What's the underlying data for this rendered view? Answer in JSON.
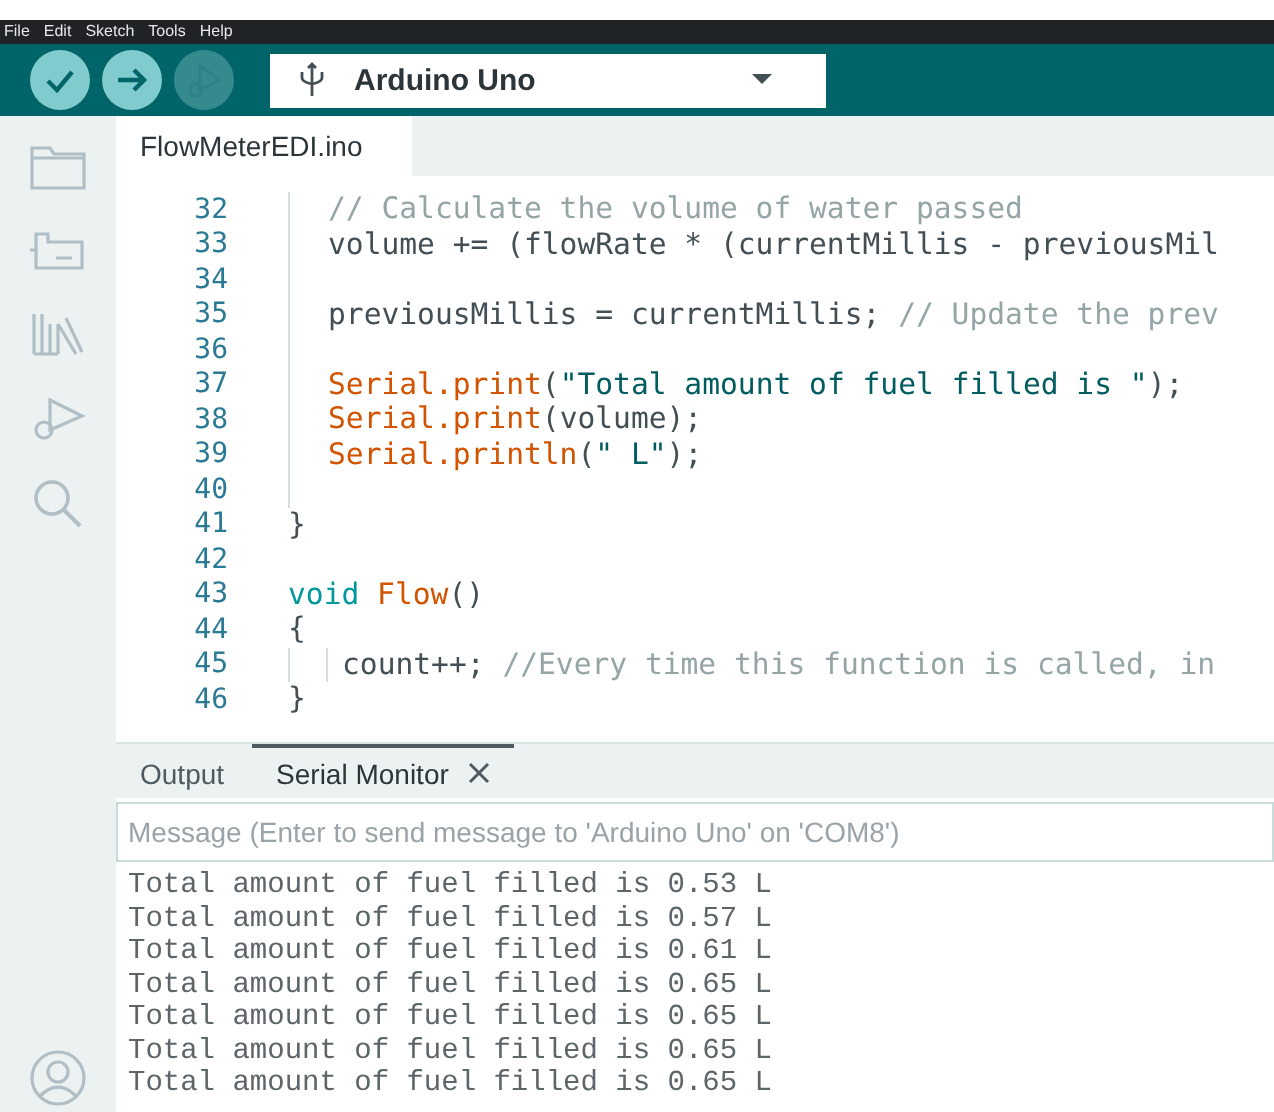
{
  "menu": [
    "File",
    "Edit",
    "Sketch",
    "Tools",
    "Help"
  ],
  "toolbar": {
    "buttons": [
      {
        "kind": "verify",
        "disabled": false
      },
      {
        "kind": "upload",
        "disabled": false
      },
      {
        "kind": "debug",
        "disabled": true
      }
    ],
    "board": "Arduino Uno"
  },
  "sidebar": {
    "items": [
      {
        "kind": "folder"
      },
      {
        "kind": "board"
      },
      {
        "kind": "library"
      },
      {
        "kind": "debug"
      },
      {
        "kind": "search"
      }
    ],
    "bottom": {
      "kind": "account"
    }
  },
  "editor": {
    "tab": "FlowMeterEDI.ino",
    "lines": [
      {
        "number": "32",
        "kind": "indented",
        "tokens": [
          {
            "kind": "comment",
            "text": "// Calculate the volume of water passed"
          }
        ]
      },
      {
        "number": "33",
        "kind": "indented",
        "tokens": [
          {
            "kind": "plain",
            "text": "volume += (flowRate * (currentMillis - previousMil"
          }
        ]
      },
      {
        "number": "34",
        "kind": "indented"
      },
      {
        "number": "35",
        "kind": "indented",
        "tokens": [
          {
            "kind": "plain",
            "text": "previousMillis = currentMillis; "
          },
          {
            "kind": "comment",
            "text": "// Update the prev"
          }
        ]
      },
      {
        "number": "36",
        "kind": "indented"
      },
      {
        "number": "37",
        "kind": "indented",
        "tokens": [
          {
            "kind": "function",
            "text": "Serial.print"
          },
          {
            "kind": "plain",
            "text": "("
          },
          {
            "kind": "string",
            "text": "\"Total amount of fuel filled is \""
          },
          {
            "kind": "plain",
            "text": ");"
          }
        ]
      },
      {
        "number": "38",
        "kind": "indented",
        "tokens": [
          {
            "kind": "function",
            "text": "Serial.print"
          },
          {
            "kind": "plain",
            "text": "(volume);"
          }
        ]
      },
      {
        "number": "39",
        "kind": "indented",
        "tokens": [
          {
            "kind": "function",
            "text": "Serial.println"
          },
          {
            "kind": "plain",
            "text": "("
          },
          {
            "kind": "string",
            "text": "\" L\""
          },
          {
            "kind": "plain",
            "text": ");"
          }
        ]
      },
      {
        "number": "40",
        "kind": "indented"
      },
      {
        "number": "41",
        "kind": "top",
        "tokens": [
          {
            "kind": "plain",
            "text": "}"
          }
        ]
      },
      {
        "number": "42",
        "kind": "top"
      },
      {
        "number": "43",
        "kind": "top",
        "tokens": [
          {
            "kind": "keyword",
            "text": "void "
          },
          {
            "kind": "function",
            "text": "Flow"
          },
          {
            "kind": "plain",
            "text": "()"
          }
        ]
      },
      {
        "number": "44",
        "kind": "top",
        "tokens": [
          {
            "kind": "plain",
            "text": "{"
          }
        ]
      },
      {
        "number": "45",
        "kind": "nested",
        "tokens": [
          {
            "kind": "plain",
            "text": "count++; "
          },
          {
            "kind": "comment",
            "text": "//Every time this function is called, in"
          }
        ]
      },
      {
        "number": "46",
        "kind": "top",
        "tokens": [
          {
            "kind": "plain",
            "text": "}"
          }
        ]
      }
    ]
  },
  "panel": {
    "tabs": [
      {
        "label": "Output",
        "selected": false,
        "closable": false
      },
      {
        "label": "Serial Monitor",
        "selected": true,
        "closable": true
      }
    ],
    "message": {
      "placeholder": "Message (Enter to send message to 'Arduino Uno' on 'COM8')"
    },
    "output": [
      "Total amount of fuel filled is 0.53 L",
      "Total amount of fuel filled is 0.57 L",
      "Total amount of fuel filled is 0.61 L",
      "Total amount of fuel filled is 0.65 L",
      "Total amount of fuel filled is 0.65 L",
      "Total amount of fuel filled is 0.65 L",
      "Total amount of fuel filled is 0.65 L"
    ]
  }
}
